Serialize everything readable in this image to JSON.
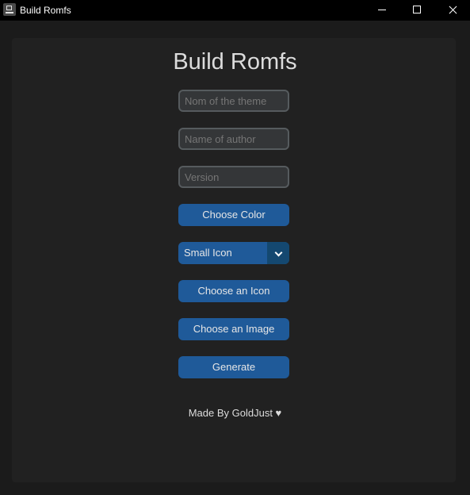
{
  "window": {
    "title": "Build Romfs",
    "icon": "app-icon"
  },
  "main": {
    "heading": "Build Romfs",
    "fields": {
      "theme_placeholder": "Nom of the theme",
      "theme_value": "",
      "author_placeholder": "Name of author",
      "author_value": "",
      "version_placeholder": "Version",
      "version_value": ""
    },
    "buttons": {
      "choose_color": "Choose Color",
      "choose_icon": "Choose an Icon",
      "choose_image": "Choose an Image",
      "generate": "Generate"
    },
    "icon_size_select": {
      "selected": "Small Icon",
      "arrow_icon": "chevron-down-icon"
    },
    "footer": "Made By GoldJust ♥"
  },
  "colors": {
    "background": "#1b1b1b",
    "panel": "#212121",
    "accent": "#1f5a99",
    "accent_dark": "#144870",
    "field_bg": "#343638",
    "field_border": "#565b5e"
  }
}
